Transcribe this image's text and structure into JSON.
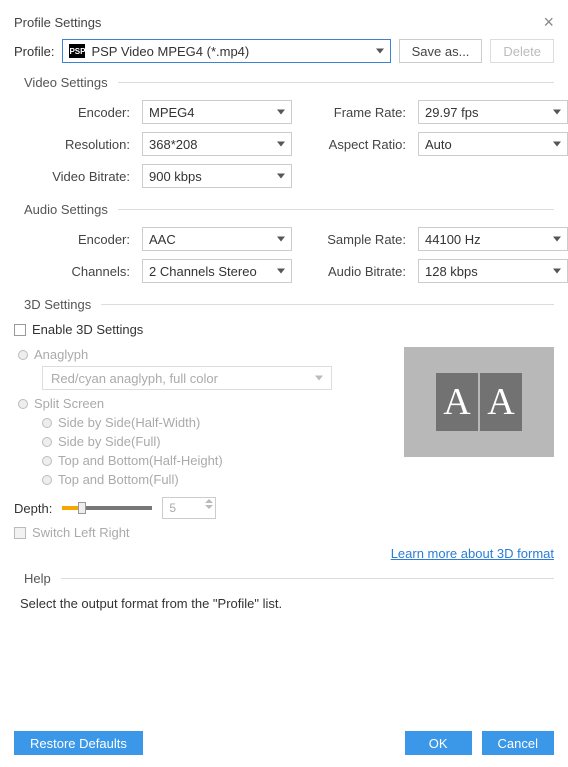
{
  "dialog": {
    "title": "Profile Settings"
  },
  "profile": {
    "label": "Profile:",
    "icon_text": "PSP",
    "value": "PSP Video MPEG4 (*.mp4)",
    "save_as": "Save as...",
    "delete": "Delete"
  },
  "video": {
    "section": "Video Settings",
    "encoder_label": "Encoder:",
    "encoder_value": "MPEG4",
    "resolution_label": "Resolution:",
    "resolution_value": "368*208",
    "bitrate_label": "Video Bitrate:",
    "bitrate_value": "900 kbps",
    "framerate_label": "Frame Rate:",
    "framerate_value": "29.97 fps",
    "aspect_label": "Aspect Ratio:",
    "aspect_value": "Auto"
  },
  "audio": {
    "section": "Audio Settings",
    "encoder_label": "Encoder:",
    "encoder_value": "AAC",
    "channels_label": "Channels:",
    "channels_value": "2 Channels Stereo",
    "samplerate_label": "Sample Rate:",
    "samplerate_value": "44100 Hz",
    "bitrate_label": "Audio Bitrate:",
    "bitrate_value": "128 kbps"
  },
  "three_d": {
    "section": "3D Settings",
    "enable": "Enable 3D Settings",
    "anaglyph": "Anaglyph",
    "anaglyph_value": "Red/cyan anaglyph, full color",
    "split": "Split Screen",
    "sbs_half": "Side by Side(Half-Width)",
    "sbs_full": "Side by Side(Full)",
    "tb_half": "Top and Bottom(Half-Height)",
    "tb_full": "Top and Bottom(Full)",
    "depth_label": "Depth:",
    "depth_value": "5",
    "switch": "Switch Left Right",
    "learn_more": "Learn more about 3D format",
    "preview_letter": "A"
  },
  "help": {
    "section": "Help",
    "text": "Select the output format from the \"Profile\" list."
  },
  "footer": {
    "restore": "Restore Defaults",
    "ok": "OK",
    "cancel": "Cancel"
  }
}
